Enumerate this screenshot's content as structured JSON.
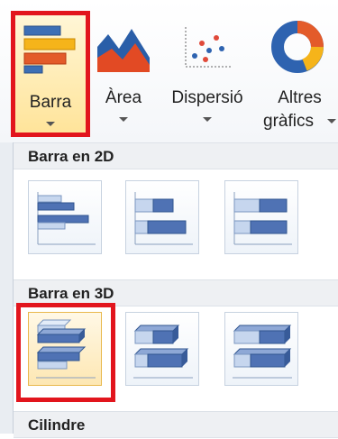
{
  "ribbon": {
    "buttons": [
      {
        "label": "Barra",
        "icon": "bar-chart-icon",
        "selected": true
      },
      {
        "label": "Àrea",
        "icon": "area-chart-icon",
        "selected": false
      },
      {
        "label": "Dispersió",
        "icon": "scatter-chart-icon",
        "selected": false
      },
      {
        "label_line1": "Altres",
        "label_line2": "gràfics",
        "icon": "doughnut-chart-icon",
        "selected": false
      }
    ]
  },
  "menu": {
    "sections": [
      {
        "title": "Barra en 2D",
        "items": [
          "clustered-bar-icon",
          "stacked-bar-icon",
          "100-stacked-bar-icon"
        ]
      },
      {
        "title": "Barra en 3D",
        "items": [
          "clustered-bar-3d-icon",
          "stacked-bar-3d-icon",
          "100-stacked-bar-3d-icon"
        ],
        "selected_index": 0
      },
      {
        "title": "Cilindre"
      }
    ]
  },
  "colors": {
    "highlight_red": "#e2151d",
    "bar_blue": "#4f72b4",
    "bar_light": "#c6d6ee"
  }
}
